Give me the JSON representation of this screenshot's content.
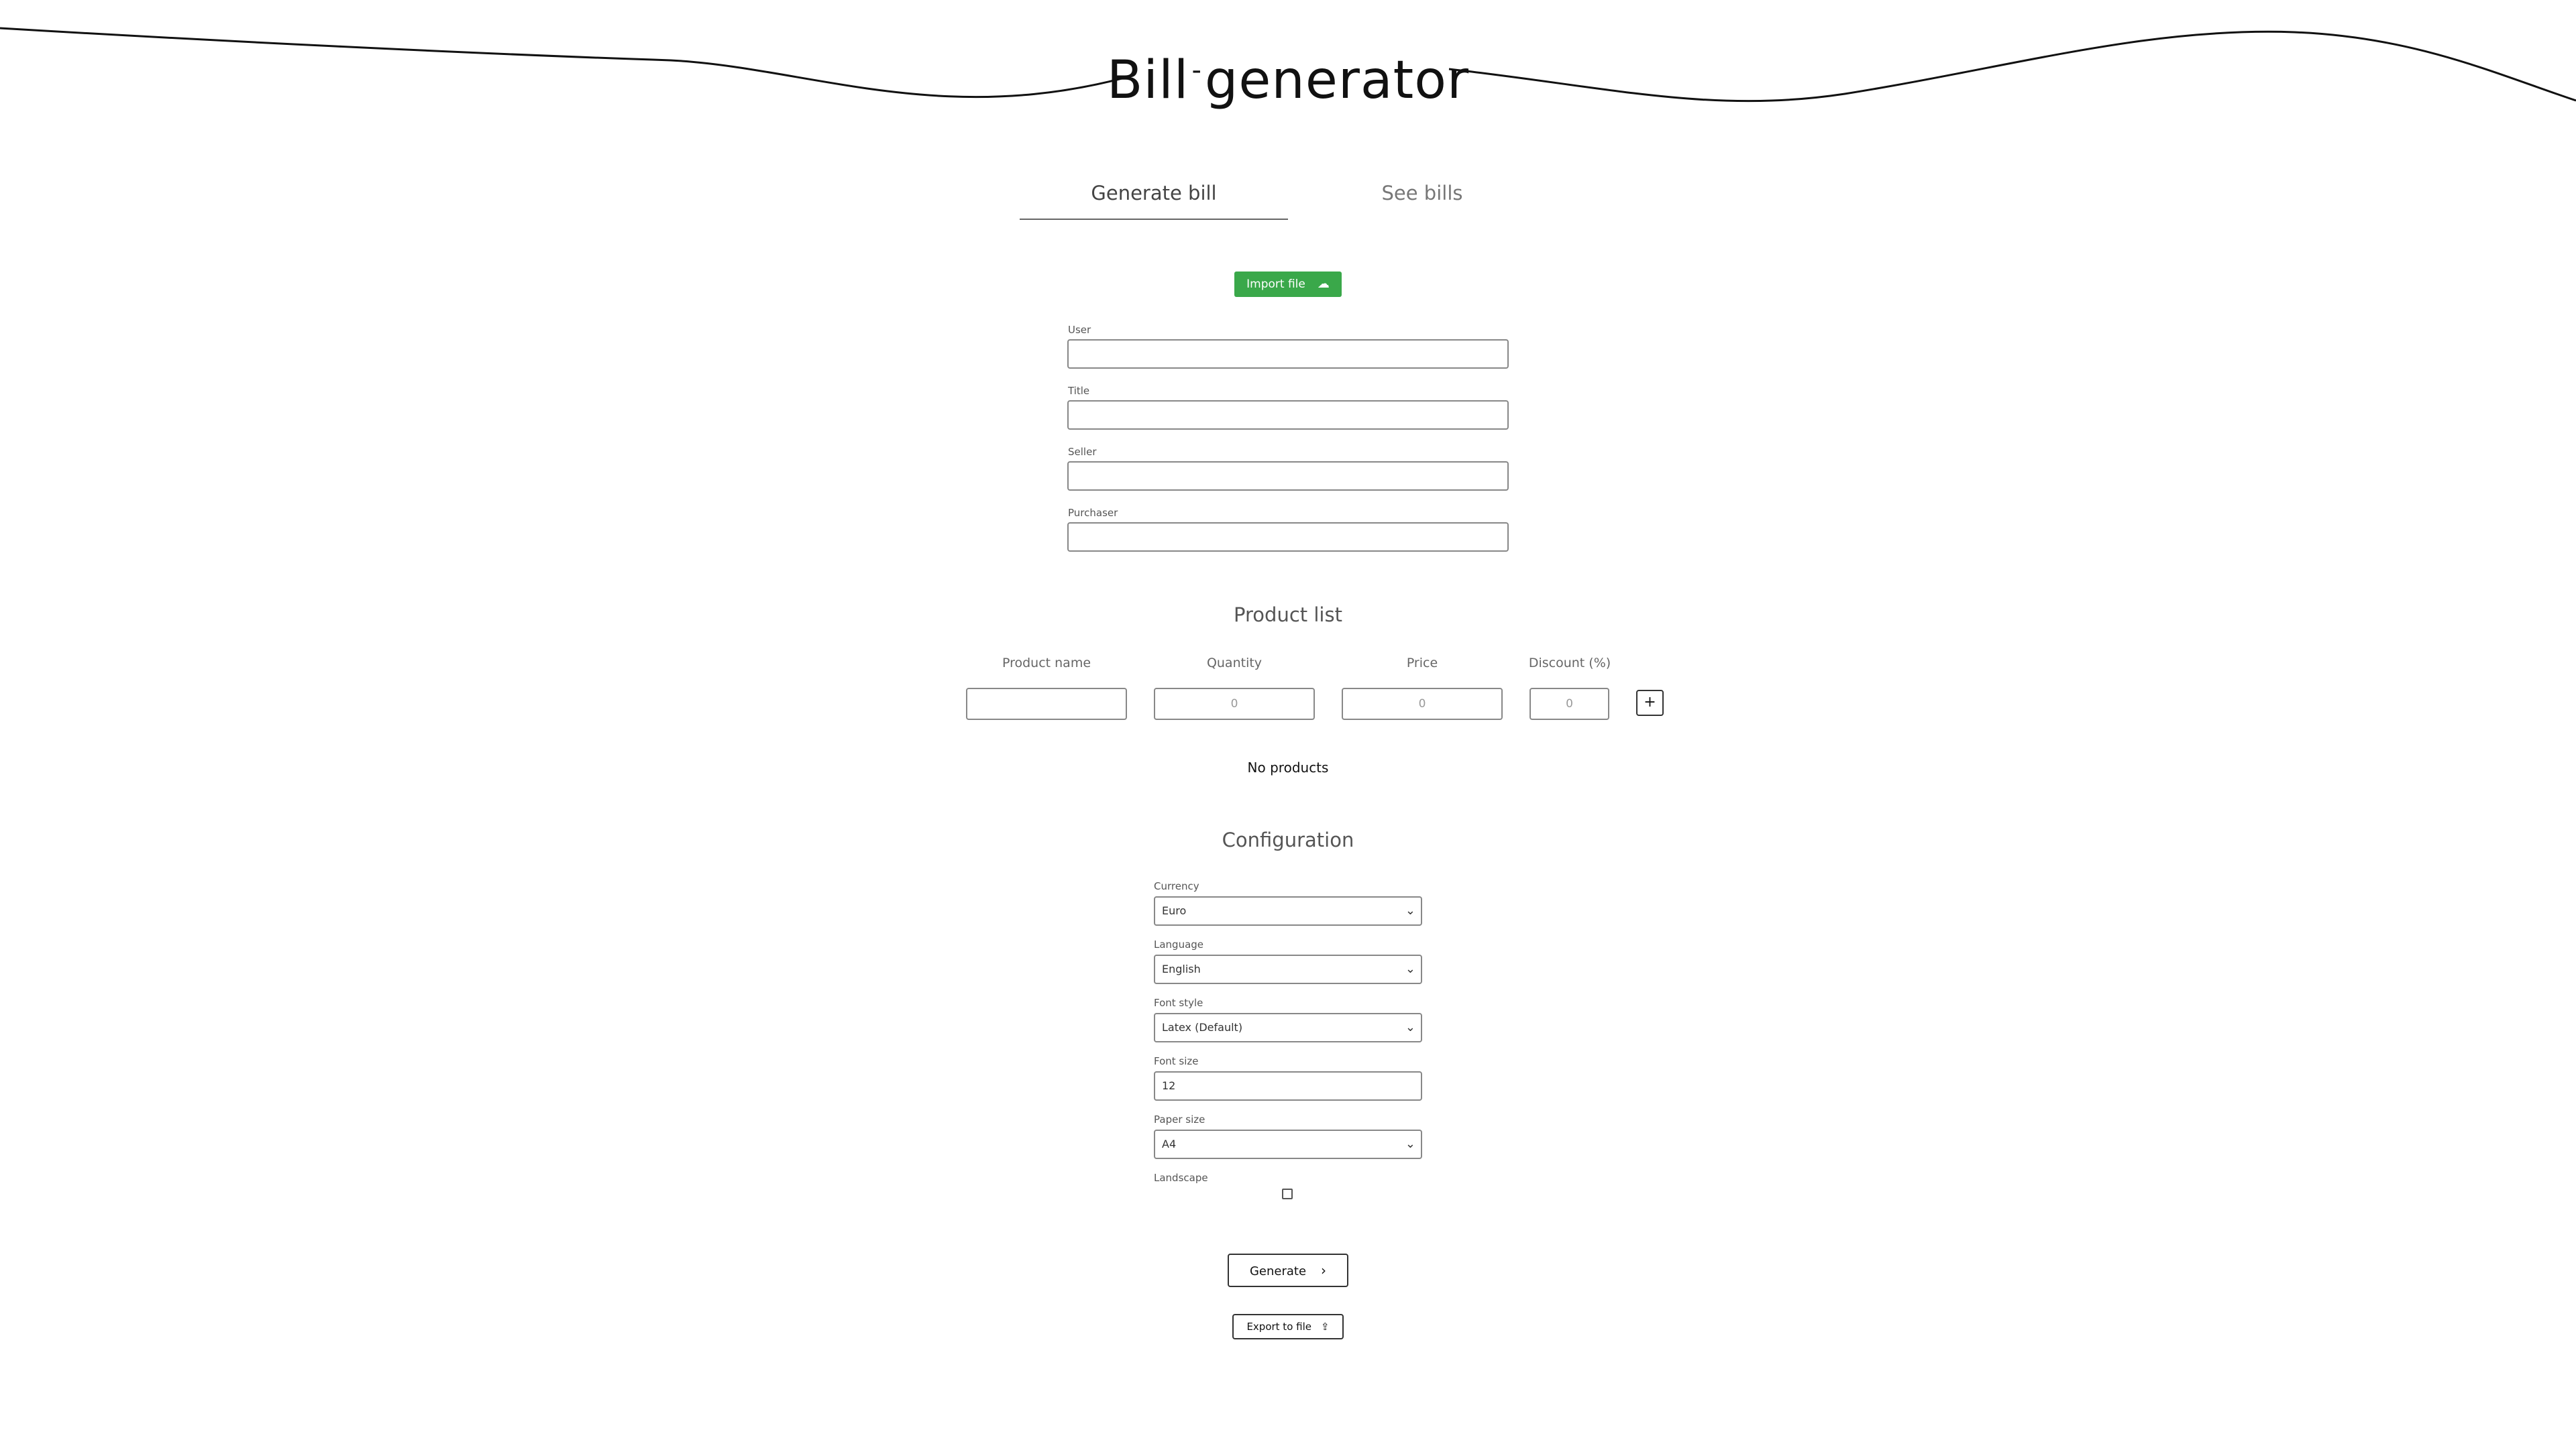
{
  "header": {
    "title_part1": "Bill",
    "title_sep": "-",
    "title_part2": "generator"
  },
  "tabs": [
    {
      "label": "Generate bill",
      "active": true
    },
    {
      "label": "See bills",
      "active": false
    }
  ],
  "import_button": {
    "label": "Import file",
    "icon": "cloud-upload-icon",
    "color": "#3aa84a"
  },
  "form": {
    "fields": [
      {
        "label": "User",
        "value": ""
      },
      {
        "label": "Title",
        "value": ""
      },
      {
        "label": "Seller",
        "value": ""
      },
      {
        "label": "Purchaser",
        "value": ""
      }
    ]
  },
  "product_list": {
    "title": "Product list",
    "columns": [
      "Product name",
      "Quantity",
      "Price",
      "Discount (%)"
    ],
    "inputs": {
      "product_name": "",
      "quantity_placeholder": "0",
      "price_placeholder": "0",
      "discount_placeholder": "0"
    },
    "add_label": "+",
    "empty_text": "No products"
  },
  "configuration": {
    "title": "Configuration",
    "currency": {
      "label": "Currency",
      "value": "Euro"
    },
    "language": {
      "label": "Language",
      "value": "English"
    },
    "font_style": {
      "label": "Font style",
      "value": "Latex (Default)"
    },
    "font_size": {
      "label": "Font size",
      "value": "12"
    },
    "paper_size": {
      "label": "Paper size",
      "value": "A4"
    },
    "landscape": {
      "label": "Landscape",
      "checked": false
    }
  },
  "actions": {
    "generate_label": "Generate",
    "export_label": "Export to file"
  }
}
